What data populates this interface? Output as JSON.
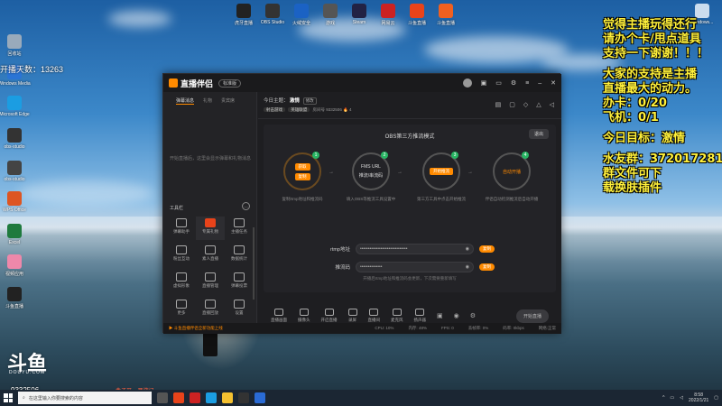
{
  "desktop": {
    "icons": [
      {
        "label": "回收站",
        "color": "#9ab"
      },
      {
        "label": "Windows Media",
        "color": "#2a74d5"
      },
      {
        "label": "Microsoft Edge",
        "color": "#1b9de2"
      },
      {
        "label": "obs-studio",
        "color": "#333"
      },
      {
        "label": "obs-studio",
        "color": "#444"
      },
      {
        "label": "WPS Office",
        "color": "#d52"
      },
      {
        "label": "Excel",
        "color": "#1f7a3e"
      },
      {
        "label": "视频应用",
        "color": "#e8a"
      },
      {
        "label": "斗鱼直播",
        "color": "#222"
      }
    ],
    "top_icons": [
      {
        "label": "虎牙直播",
        "color": "#222"
      },
      {
        "label": "OBS Studio",
        "color": "#333"
      },
      {
        "label": "火绒安全",
        "color": "#1b62c4"
      },
      {
        "label": "游戏",
        "color": "#555"
      },
      {
        "label": "Steam",
        "color": "#224"
      },
      {
        "label": "网易云",
        "color": "#c22"
      },
      {
        "label": "斗鱼直播",
        "color": "#e8431a"
      },
      {
        "label": "斗鱼直播",
        "color": "#f06020"
      }
    ],
    "recycle_top_right": "Windows...",
    "counter": "开播天数：13263"
  },
  "right_overlay": {
    "lines": [
      "觉得主播玩得还行",
      "请办个卡/甩点道具",
      "支持一下谢谢！！！",
      "",
      "大家的支持是主播",
      "直播最大的动力。",
      "  办卡：0/20",
      "  飞机：0/1",
      "",
      "  今日目标：激情",
      "",
      "  水友群：372017281",
      "  群文件可下",
      "  载换肤插件"
    ]
  },
  "app": {
    "name": "直播伴侣",
    "version": "标准版",
    "left_tabs": [
      "弹幕消息",
      "礼物",
      "贵宾席"
    ],
    "left_empty": "开始直播后，这里会显示弹幕和礼物消息",
    "tools_title": "工具栏",
    "tools": [
      {
        "label": "弹幕助手",
        "highlight": false
      },
      {
        "label": "专属礼物",
        "highlight": true
      },
      {
        "label": "主播任务",
        "highlight": false
      },
      {
        "label": "粉丝互动",
        "highlight": false
      },
      {
        "label": "素人直播",
        "highlight": false
      },
      {
        "label": "数据统计",
        "highlight": false
      },
      {
        "label": "虚拟形象",
        "highlight": false
      },
      {
        "label": "直播管理",
        "highlight": false
      },
      {
        "label": "弹幕投票",
        "highlight": false
      },
      {
        "label": "更多",
        "highlight": false
      },
      {
        "label": "直播回放",
        "highlight": false
      },
      {
        "label": "设置",
        "highlight": false
      }
    ],
    "top": {
      "topic_label": "今日主题",
      "topic": "激情",
      "edit": "修改",
      "category": "射击游戏",
      "sub": "英雄联盟",
      "room_label": "房间号",
      "room_id": "9332506",
      "hot": "4"
    },
    "panel": {
      "title": "OBS第三方推流模式",
      "exit": "退出",
      "steps": [
        {
          "num": "1",
          "btns": [
            "获取",
            "复制"
          ],
          "desc": "复制rtmp地址和推流码"
        },
        {
          "num": "2",
          "text": "FMS URL",
          "text2": "推流/串流码",
          "desc": "填入OBS等推流工具设置中"
        },
        {
          "num": "3",
          "otext": "开始推流",
          "desc": "第三方工具中点击开始推流"
        },
        {
          "num": "4",
          "text": "自动开播",
          "desc": "伴侣自动检测推流后自动开播"
        }
      ],
      "rtmp_label": "rtmp地址",
      "rtmp_value": "••••••••••••••••••••••••••••••",
      "key_label": "推流码",
      "key_value": "••••••••••••••",
      "copy": "复制",
      "hint": "开播后rtmp地址和推流码会更新，下次需要重新填写"
    },
    "bottom_tools": [
      "直播画面",
      "摄像头",
      "开启直播",
      "录屏",
      "直播间",
      "麦克风",
      "扬声器"
    ],
    "start_button": "开始直播",
    "status": {
      "notice": "▶ 斗鱼直播伴侣全新功能上线",
      "items": [
        "CPU: 10%",
        "内存: 48%",
        "FPS: 0",
        "丢帧率: 0%",
        "码率: 0kbps",
        "网络:正常"
      ]
    }
  },
  "watermark": {
    "brand": "斗鱼",
    "sub": "DOUYU.COM",
    "room": "9332506",
    "notice": "盒子开... 西游记"
  },
  "taskbar": {
    "search_placeholder": "在这里输入你要搜索的内容",
    "time": "8:58",
    "date": "2022/1/21"
  }
}
